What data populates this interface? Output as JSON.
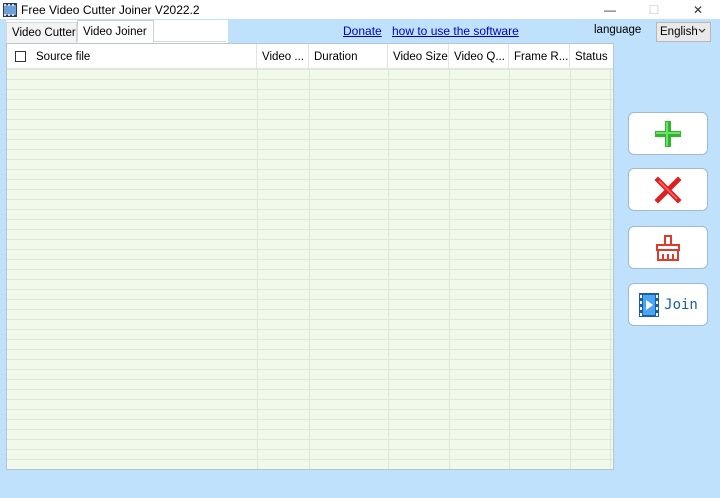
{
  "window": {
    "title": "Free Video Cutter Joiner V2022.2",
    "controls": [
      {
        "name": "minimize",
        "glyph": "—"
      },
      {
        "name": "maximize",
        "glyph": "☐"
      },
      {
        "name": "close",
        "glyph": "✕"
      }
    ]
  },
  "tabs": [
    {
      "label": "Video Cutter",
      "active": false
    },
    {
      "label": "Video Joiner",
      "active": true
    }
  ],
  "links": {
    "donate": "Donate",
    "howto": "how to use the software"
  },
  "language": {
    "label": "language",
    "selected": "English"
  },
  "table": {
    "columns": [
      "Source file",
      "Video ...",
      "Duration",
      "Video Size",
      "Video Q...",
      "Frame R...",
      "Status"
    ],
    "rows": []
  },
  "actions": {
    "add": {
      "icon": "plus-icon",
      "color": "#2db82d"
    },
    "remove": {
      "icon": "x-icon",
      "color": "#e02020"
    },
    "clear": {
      "icon": "broom-icon",
      "color": "#e03a2a"
    },
    "join": {
      "icon": "film-icon",
      "label": "Join",
      "color": "#1a5ea8"
    }
  },
  "colors": {
    "window_bg": "#bfe1fb",
    "list_bg": "#f1f9ea",
    "link": "#0000cc"
  }
}
